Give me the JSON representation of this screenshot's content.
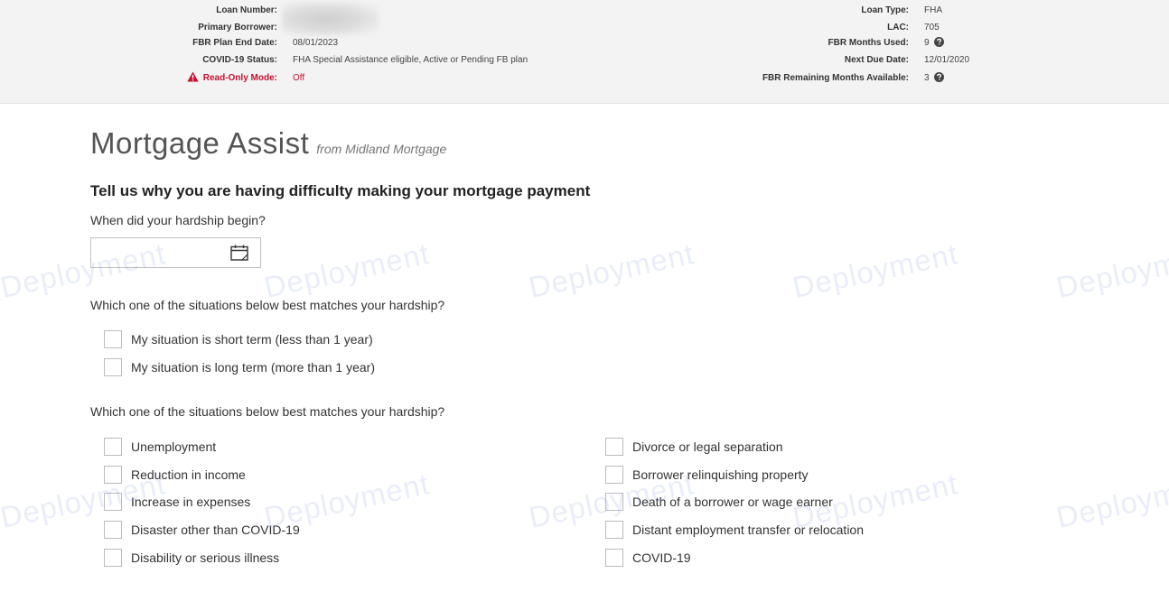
{
  "header": {
    "left": {
      "loan_number_label": "Loan Number:",
      "primary_borrower_label": "Primary Borrower:",
      "fbr_plan_end_label": "FBR Plan End Date:",
      "fbr_plan_end_value": "08/01/2023",
      "covid_status_label": "COVID-19 Status:",
      "covid_status_value": "FHA Special Assistance eligible, Active or Pending FB plan",
      "read_only_label": "Read-Only Mode:",
      "read_only_value": "Off"
    },
    "right": {
      "loan_type_label": "Loan Type:",
      "loan_type_value": "FHA",
      "lac_label": "LAC:",
      "lac_value": "705",
      "fbr_months_used_label": "FBR Months Used:",
      "fbr_months_used_value": "9",
      "next_due_label": "Next Due Date:",
      "next_due_value": "12/01/2020",
      "fbr_remaining_label": "FBR Remaining Months Available:",
      "fbr_remaining_value": "3"
    }
  },
  "main": {
    "title": "Mortgage Assist",
    "subtitle": "from Midland Mortgage",
    "heading": "Tell us why you are having difficulty making your mortgage payment",
    "q_start": "When did your hardship begin?",
    "date_value": "",
    "q_term": "Which one of the situations below best matches your hardship?",
    "term_options": [
      "My situation is short term (less than 1 year)",
      "My situation is long term (more than 1 year)"
    ],
    "q_reason": "Which one of the situations below best matches your hardship?",
    "reasons_left": [
      "Unemployment",
      "Reduction in income",
      "Increase in expenses",
      "Disaster other than COVID-19",
      "Disability or serious illness"
    ],
    "reasons_right": [
      "Divorce or legal separation",
      "Borrower relinquishing property",
      "Death of a borrower or wage earner",
      "Distant employment transfer or relocation",
      "COVID-19"
    ]
  },
  "watermark": "Deployment",
  "colors": {
    "header_bg": "#f3f3f3",
    "alert_red": "#c8102e",
    "text": "#222222",
    "watermark": "#788cdc"
  },
  "icons": [
    "warning-icon",
    "help-circle-icon",
    "calendar-icon"
  ]
}
